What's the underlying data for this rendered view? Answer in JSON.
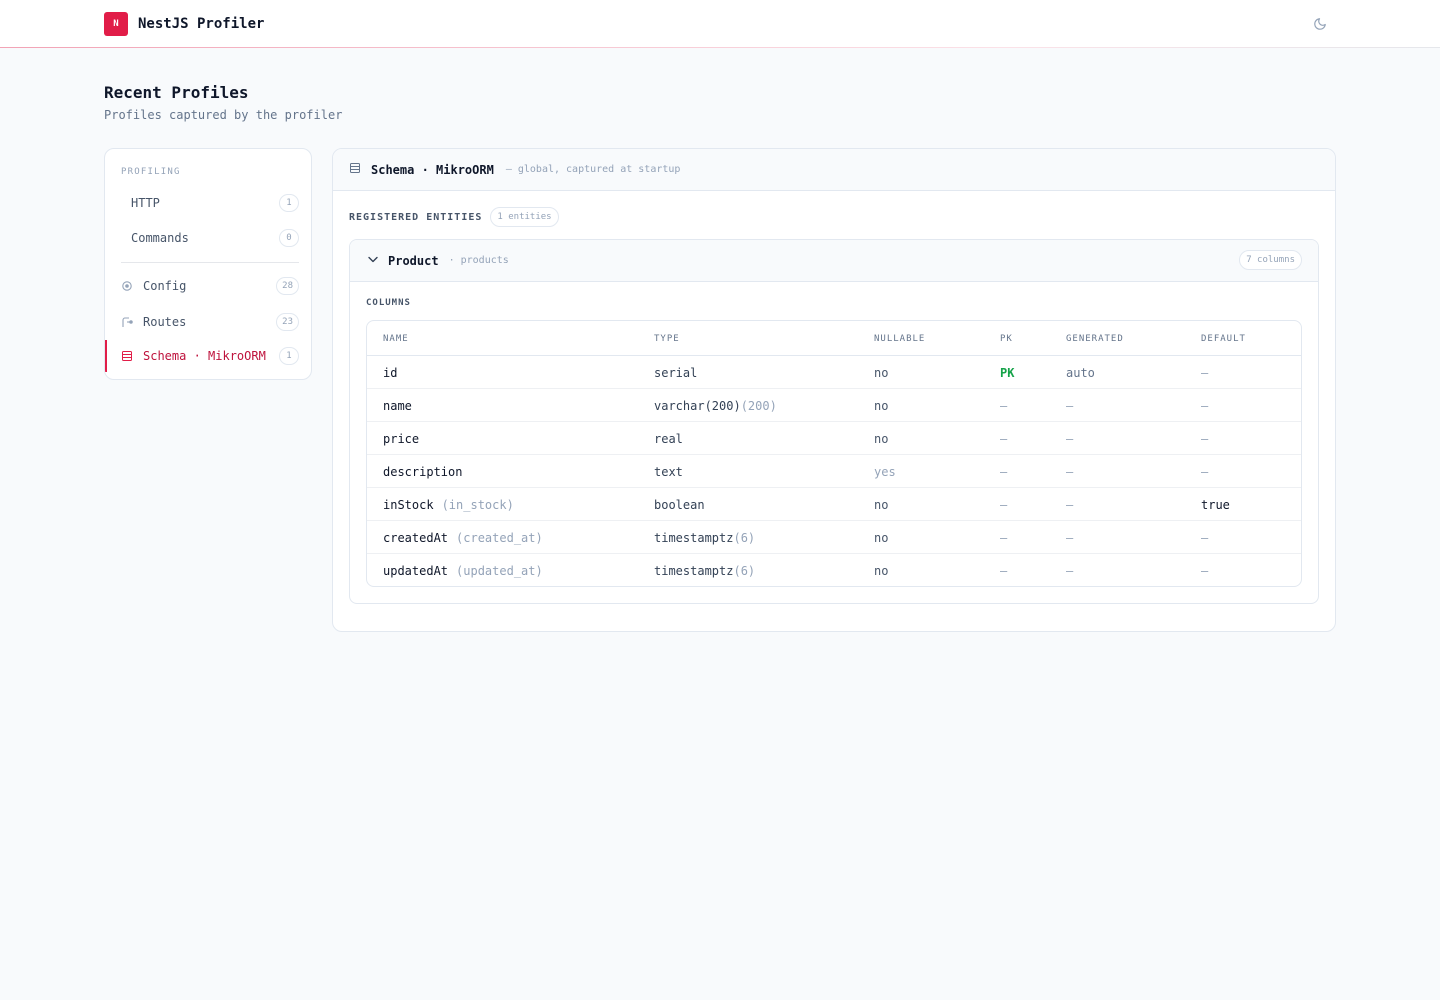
{
  "app": {
    "logo_letter": "N",
    "title": "NestJS Profiler",
    "accent": "#e11d48"
  },
  "theme_toggle": {
    "icon": "moon-icon"
  },
  "page": {
    "title": "Recent Profiles",
    "subtitle": "Profiles captured by the profiler"
  },
  "sidebar": {
    "heading": "PROFILING",
    "items": [
      {
        "label": "HTTP",
        "count": "1",
        "icon": ""
      },
      {
        "label": "Commands",
        "count": "0",
        "icon": ""
      },
      {
        "label": "Config",
        "count": "28",
        "icon": "config-icon"
      },
      {
        "label": "Routes",
        "count": "23",
        "icon": "routes-icon"
      },
      {
        "label": "Schema · MikroORM",
        "count": "1",
        "icon": "database-icon",
        "active": true
      }
    ]
  },
  "main": {
    "title": "Schema · MikroORM",
    "subtitle": "— global, captured at startup",
    "registered_label": "REGISTERED ENTITIES",
    "entities_count": "1 entities",
    "entity": {
      "name": "Product",
      "table": "· products",
      "columns_count": "7 columns",
      "columns_label": "COLUMNS",
      "headers": [
        "NAME",
        "TYPE",
        "NULLABLE",
        "PK",
        "GENERATED",
        "DEFAULT"
      ],
      "rows": [
        {
          "name": "id",
          "alias": "",
          "type": "serial",
          "type_suffix": "",
          "nullable": "no",
          "pk": "PK",
          "generated": "auto",
          "default": "—"
        },
        {
          "name": "name",
          "alias": "",
          "type": "varchar(200)",
          "type_suffix": "(200)",
          "nullable": "no",
          "pk": "—",
          "generated": "—",
          "default": "—"
        },
        {
          "name": "price",
          "alias": "",
          "type": "real",
          "type_suffix": "",
          "nullable": "no",
          "pk": "—",
          "generated": "—",
          "default": "—"
        },
        {
          "name": "description",
          "alias": "",
          "type": "text",
          "type_suffix": "",
          "nullable": "yes",
          "pk": "—",
          "generated": "—",
          "default": "—"
        },
        {
          "name": "inStock",
          "alias": "(in_stock)",
          "type": "boolean",
          "type_suffix": "",
          "nullable": "no",
          "pk": "—",
          "generated": "—",
          "default": "true"
        },
        {
          "name": "createdAt",
          "alias": "(created_at)",
          "type": "timestamptz",
          "type_suffix": "(6)",
          "nullable": "no",
          "pk": "—",
          "generated": "—",
          "default": "—"
        },
        {
          "name": "updatedAt",
          "alias": "(updated_at)",
          "type": "timestamptz",
          "type_suffix": "(6)",
          "nullable": "no",
          "pk": "—",
          "generated": "—",
          "default": "—"
        }
      ]
    }
  }
}
